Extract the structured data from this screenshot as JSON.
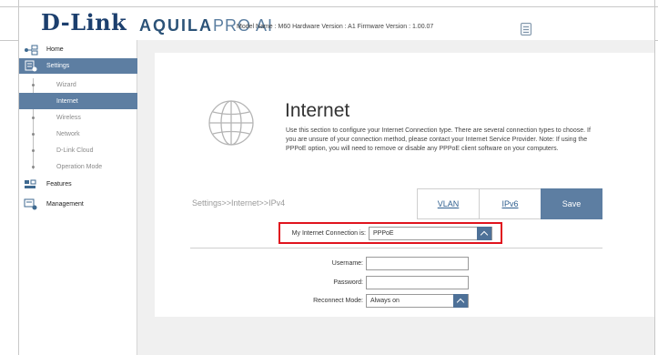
{
  "header": {
    "logo": "D-Link",
    "brand_main": "AQUILA",
    "brand_pro": "PRO AI",
    "model_info": "Model Name : M60 Hardware Version : A1 Firmware Version : 1.00.07",
    "notes_icon": "notes-icon"
  },
  "sidebar": {
    "home": "Home",
    "settings": "Settings",
    "sub_items": [
      "Wizard",
      "Internet",
      "Wireless",
      "Network",
      "D-Link Cloud",
      "Operation Mode"
    ],
    "features": "Features",
    "management": "Management"
  },
  "main": {
    "title": "Internet",
    "description": "Use this section to configure your Internet Connection type. There are several connection types to choose. If you are unsure of your connection method, please contact your Internet Service Provider. Note: If using the PPPoE option, you will need to remove or disable any PPPoE client software on your computers.",
    "breadcrumb": "Settings>>Internet>>IPv4",
    "tabs": {
      "vlan": "VLAN",
      "ipv6": "IPv6",
      "save": "Save"
    },
    "connection": {
      "label": "My Internet Connection is:",
      "value": "PPPoE"
    },
    "username": {
      "label": "Username:",
      "value": ""
    },
    "password": {
      "label": "Password:",
      "value": ""
    },
    "reconnect": {
      "label": "Reconnect Mode:",
      "value": "Always on"
    },
    "colors": {
      "accent": "#5d7ea2",
      "highlight": "#e0141e",
      "brand": "#1c3f6e"
    }
  }
}
